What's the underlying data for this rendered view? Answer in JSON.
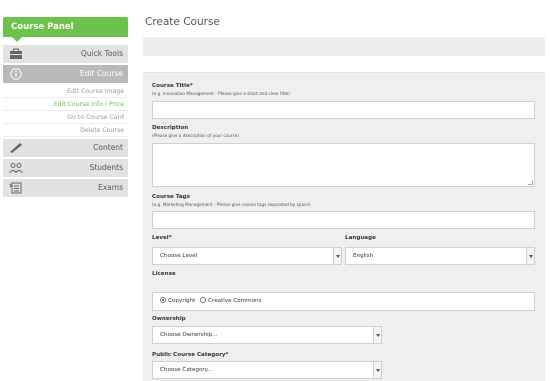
{
  "sidebar": {
    "panel_title": "Course Panel",
    "items": [
      {
        "label": "Quick Tools",
        "icon": "toolbox-icon"
      },
      {
        "label": "Edit Course",
        "icon": "info-icon",
        "active": true
      },
      {
        "label": "Content",
        "icon": "pen-icon"
      },
      {
        "label": "Students",
        "icon": "students-icon"
      },
      {
        "label": "Exams",
        "icon": "exam-icon"
      }
    ],
    "sub_items": [
      {
        "label": "Edit Course Image"
      },
      {
        "label": "Edit Course Info / Price",
        "current": true
      },
      {
        "label": "Go to Course Card"
      },
      {
        "label": "Delete Course"
      }
    ]
  },
  "main": {
    "title": "Create Course",
    "form": {
      "course_title_label": "Course Title*",
      "course_title_hint": "(e.g. Innovation Management - Please give a short and clear title)",
      "course_title_value": "",
      "description_label": "Description",
      "description_hint": "(Please give a description of your course)",
      "description_value": "",
      "tags_label": "Course Tags",
      "tags_hint": "(e.g. Marketing Management - Please give course tags separated by space)",
      "tags_value": "",
      "level_label": "Level*",
      "level_value": "Choose Level",
      "language_label": "Language",
      "language_value": "English",
      "license_label": "License",
      "license_options": [
        "Copyright",
        "Creative Commons"
      ],
      "license_selected": "Copyright",
      "ownership_label": "Ownership",
      "ownership_value": "Choose Ownership...",
      "category_label": "Public Course Category*",
      "category_value": "Choose Category..."
    }
  },
  "colors": {
    "accent": "#6cc24a",
    "active_nav": "#b9b9b9",
    "nav": "#e2e2e2",
    "form_bg": "#efefef"
  }
}
